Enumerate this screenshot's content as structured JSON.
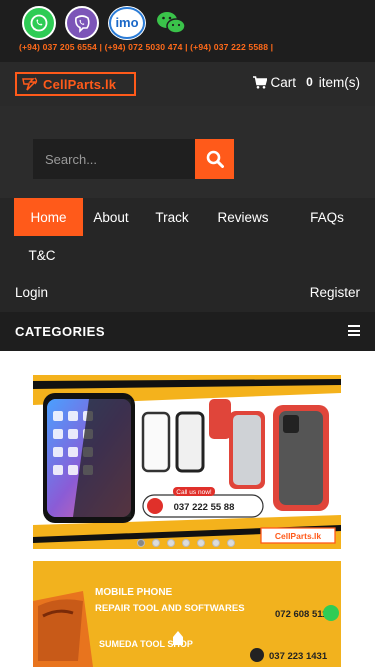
{
  "contacts": {
    "apps": [
      {
        "name": "whatsapp",
        "label": ""
      },
      {
        "name": "viber",
        "label": ""
      },
      {
        "name": "imo",
        "label": "imo"
      },
      {
        "name": "wechat",
        "label": ""
      }
    ],
    "phones_line": "(+94) 037 205 6554  |  (+94) 072 5030 474  |  (+94) 037 222 5588  |"
  },
  "header": {
    "logo_text": "CellParts.lk",
    "cart_label": "Cart",
    "cart_count": "0",
    "cart_items_label": "item(s)"
  },
  "search": {
    "placeholder": "Search..."
  },
  "nav": {
    "items": [
      {
        "label": "Home",
        "active": true
      },
      {
        "label": "About"
      },
      {
        "label": "Track"
      },
      {
        "label": "Reviews"
      },
      {
        "label": "FAQs"
      },
      {
        "label": "T&C"
      }
    ],
    "login": "Login",
    "register": "Register"
  },
  "categories": {
    "title": "CATEGORIES"
  },
  "banner1": {
    "call_us": "Call us now!",
    "phone": "037 222 55 88",
    "brand": "CellParts.lk",
    "slide_count": 7,
    "active_slide": 1
  },
  "banner2": {
    "line1": "MOBILE PHONE",
    "line2": "REPAIR TOOL AND SOFTWARES",
    "shop": "SUMEDA TOOL SHOP",
    "phone1": "072 608 5110",
    "phone2": "037 223 1431"
  },
  "colors": {
    "accent": "#ff5a1a",
    "dark": "#1e1e1e",
    "banner_yellow": "#f2b21e"
  }
}
